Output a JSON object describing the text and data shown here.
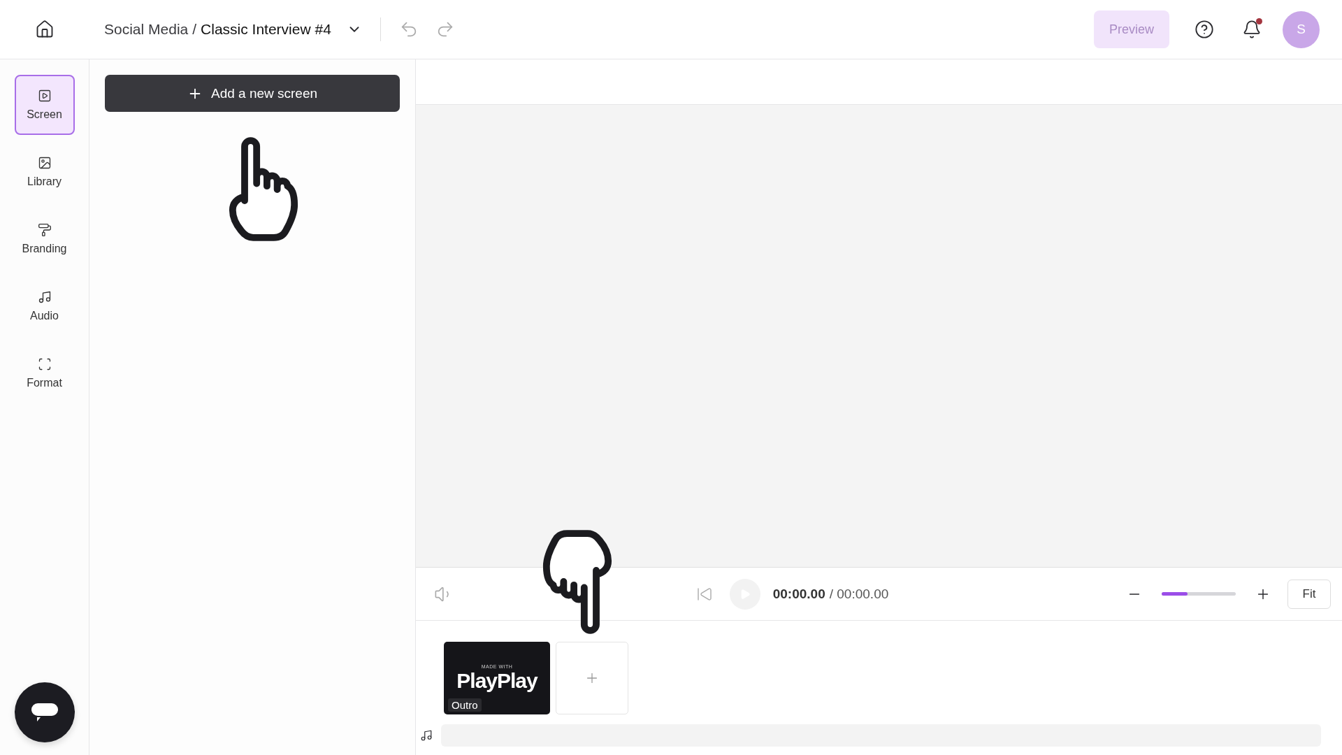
{
  "header": {
    "folder": "Social Media",
    "separator": "/",
    "title": "Classic Interview #4",
    "preview": {
      "label": "Preview",
      "disabled": true
    },
    "notifications": {
      "unread": true
    },
    "avatar": "S"
  },
  "sidebar": {
    "items": [
      {
        "kind": "screen",
        "label": "Screen",
        "selected": true
      },
      {
        "kind": "library",
        "label": "Library",
        "selected": false
      },
      {
        "kind": "branding",
        "label": "Branding",
        "selected": false
      },
      {
        "kind": "audio",
        "label": "Audio",
        "selected": false
      },
      {
        "kind": "format",
        "label": "Format",
        "selected": false
      }
    ]
  },
  "panel": {
    "add_button": "Add a new screen"
  },
  "player": {
    "current": "00:00.00",
    "total": "/ 00:00.00",
    "zoom": {
      "level": 0.35
    },
    "fit": "Fit"
  },
  "timeline": {
    "clips": [
      {
        "kind": "outro",
        "brand_small": "MADE WITH",
        "brand": "PlayPlay",
        "label": "Outro"
      }
    ]
  }
}
